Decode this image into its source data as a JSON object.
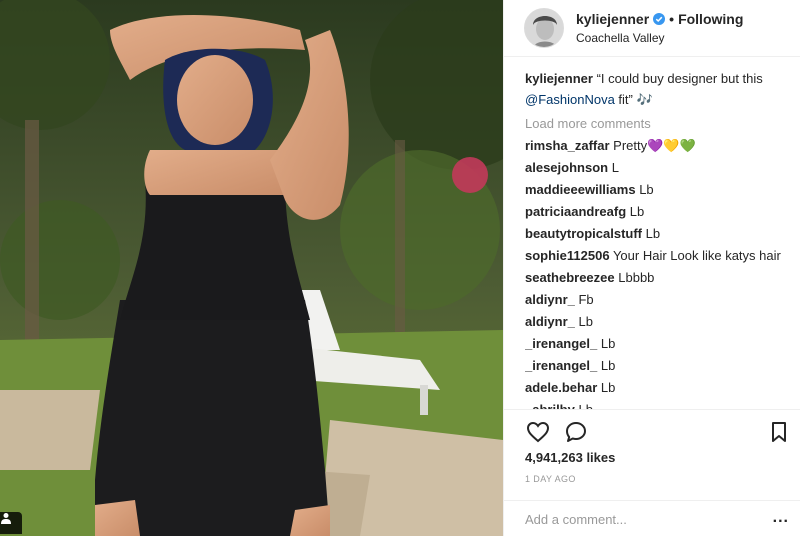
{
  "header": {
    "username": "kyliejenner",
    "separator": "•",
    "follow_label": "Following",
    "location": "Coachella Valley"
  },
  "caption": {
    "username": "kyliejenner",
    "text_before": "“I could buy designer but this",
    "mention": "@FashionNova",
    "text_after": "fit” 🎶"
  },
  "load_more_label": "Load more comments",
  "comments": [
    {
      "user": "rimsha_zaffar",
      "text": "Pretty💜💛💚"
    },
    {
      "user": "alesejohnson",
      "text": "L"
    },
    {
      "user": "maddieeewilliams",
      "text": "Lb"
    },
    {
      "user": "patriciaandreafg",
      "text": "Lb"
    },
    {
      "user": "beautytropicalstuff",
      "text": "Lb"
    },
    {
      "user": "sophie112506",
      "text": "Your Hair Look like katys hair"
    },
    {
      "user": "seathebreezee",
      "text": "Lbbbb"
    },
    {
      "user": "aldiynr_",
      "text": "Fb"
    },
    {
      "user": "aldiynr_",
      "text": "Lb"
    },
    {
      "user": "_irenangel_",
      "text": "Lb"
    },
    {
      "user": "_irenangel_",
      "text": "Lb"
    },
    {
      "user": "adele.behar",
      "text": "Lb"
    },
    {
      "user": "_abrilby",
      "text": "Lb"
    }
  ],
  "actions": {
    "like_icon": "heart-icon",
    "comment_icon": "comment-icon",
    "save_icon": "bookmark-icon"
  },
  "likes": "4,941,263 likes",
  "timestamp": "1 DAY AGO",
  "add_comment_placeholder": "Add a comment...",
  "more_options_label": "...",
  "colors": {
    "verified_blue": "#3897f0",
    "mention_blue": "#003569",
    "muted_gray": "#999999"
  }
}
